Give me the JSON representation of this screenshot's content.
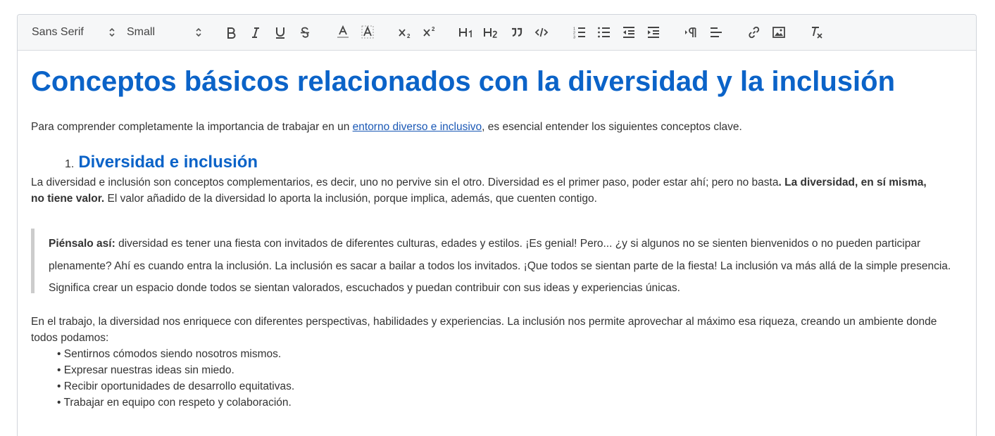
{
  "toolbar": {
    "font_family": "Sans Serif",
    "font_size": "Small",
    "buttons": [
      "bold-icon",
      "italic-icon",
      "underline-icon",
      "strike-icon",
      "text-color-icon",
      "highlight-icon",
      "subscript-icon",
      "superscript-icon",
      "heading1-icon",
      "heading2-icon",
      "blockquote-icon",
      "code-icon",
      "ordered-list-icon",
      "bullet-list-icon",
      "outdent-icon",
      "indent-icon",
      "text-direction-icon",
      "align-icon",
      "link-icon",
      "image-icon",
      "clear-format-icon"
    ]
  },
  "doc": {
    "title": "Conceptos básicos relacionados con la diversidad y la inclusión",
    "intro_before": "Para comprender completamente la importancia de trabajar en un ",
    "intro_link": "entorno diverso e inclusivo",
    "intro_after": ", es esencial entender los siguientes conceptos clave.",
    "section1_number": "1.",
    "section1_title": "Diversidad e inclusión",
    "p1_start": "La diversidad e inclusión son conceptos complementarios, es decir, uno no pervive sin el otro.  Diversidad es el primer paso, poder estar ahí; pero no basta",
    "p1_bold": ". La diversidad, en sí misma, no tiene valor.",
    "p1_end": " El valor añadido de la diversidad lo aporta la inclusión, porque implica, además, que cuenten contigo.",
    "quote_bold": "Piénsalo así:",
    "quote_text": " diversidad es tener una fiesta con invitados de diferentes culturas, edades y estilos. ¡Es genial! Pero... ¿y si algunos no se sienten bienvenidos o no pueden participar plenamente? Ahí es cuando entra la inclusión. La inclusión es sacar a bailar a todos los invitados. ¡Que todos se sientan parte de la fiesta! La inclusión va más allá de la simple presencia. Significa crear un espacio donde todos se sientan valorados, escuchados y puedan contribuir con sus ideas y experiencias únicas.",
    "p2": "En el trabajo, la diversidad nos enriquece con diferentes perspectivas, habilidades y experiencias. La inclusión nos permite aprovechar al máximo esa riqueza, creando un ambiente donde todos podamos:",
    "bullets": [
      "• Sentirnos cómodos siendo nosotros mismos.",
      "• Expresar nuestras ideas sin miedo.",
      "• Recibir oportunidades de desarrollo equitativas.",
      "• Trabajar en equipo con respeto y colaboración."
    ]
  },
  "colors": {
    "heading": "#0b63c8",
    "link": "#1a58b5",
    "toolbar_bg": "#f6f7f8"
  }
}
